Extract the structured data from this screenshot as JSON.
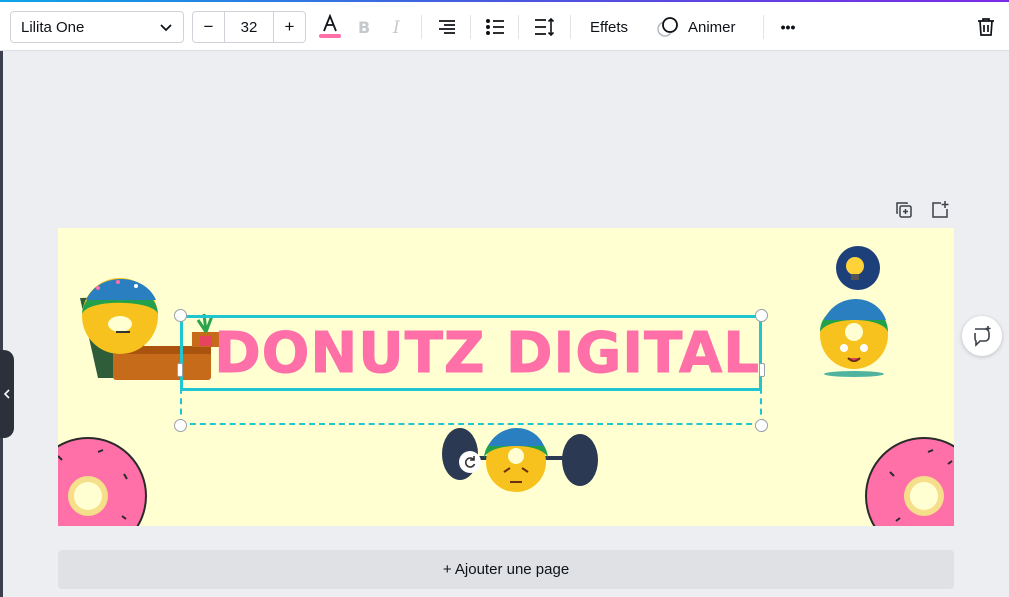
{
  "toolbar": {
    "font_name": "Lilita One",
    "font_size": "32",
    "minus_label": "−",
    "plus_label": "+",
    "effects_label": "Effets",
    "animate_label": "Animer",
    "more_label": "•••",
    "text_color": "#ff6fa8"
  },
  "canvas": {
    "background": "#ffffd2",
    "title_text": "DONUTZ DIGITAL",
    "title_color": "#ff6fa8",
    "selection_color": "#1fc6d0"
  },
  "footer": {
    "add_page_label": "+ Ajouter une page"
  },
  "icons": [
    "chevron-down-icon",
    "text-color-icon",
    "bold-icon",
    "italic-icon",
    "align-right-icon",
    "list-icon",
    "spacing-icon",
    "animate-icon",
    "more-icon",
    "trash-icon",
    "duplicate-page-icon",
    "add-page-icon",
    "rotate-icon",
    "comment-add-icon",
    "collapse-panel-icon"
  ]
}
